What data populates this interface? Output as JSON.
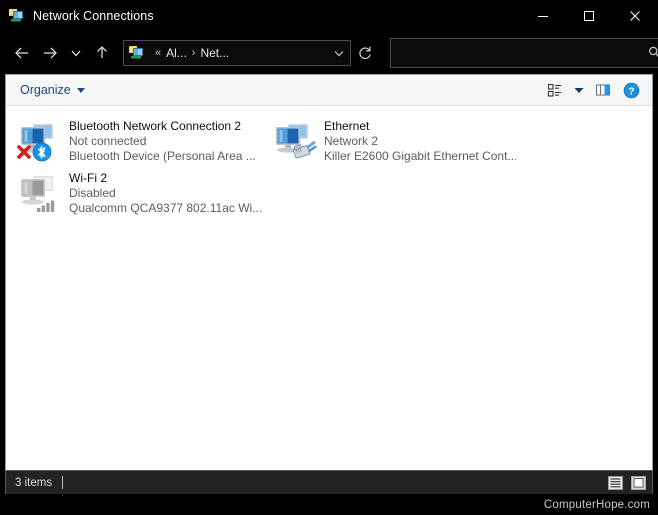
{
  "window": {
    "title": "Network Connections",
    "title_icon": "network-connections-icon",
    "minimize_label": "Minimize",
    "maximize_label": "Maximize",
    "close_label": "Close"
  },
  "nav": {
    "back_label": "Back",
    "forward_label": "Forward",
    "recent_label": "Recent locations",
    "up_label": "Up",
    "refresh_label": "Refresh",
    "address": {
      "icon": "network-connections-icon",
      "overflow": "«",
      "crumbs": [
        "Al...",
        "Net..."
      ],
      "separator": "›",
      "dropdown_label": "Previous locations"
    },
    "search": {
      "value": "",
      "placeholder": "",
      "icon": "search-icon"
    }
  },
  "toolbar": {
    "organize_label": "Organize",
    "view_options_label": "Change your view",
    "view_dropdown_label": "More options",
    "preview_pane_label": "Show the preview pane",
    "help_label": "Help"
  },
  "items": [
    {
      "name": "Bluetooth Network Connection 2",
      "status": "Not connected",
      "device": "Bluetooth Device (Personal Area ...",
      "icon": "network-adapter-bluetooth-disconnected-icon",
      "state": "disconnected"
    },
    {
      "name": "Ethernet",
      "status": "Network 2",
      "device": "Killer E2600 Gigabit Ethernet Cont...",
      "icon": "network-adapter-ethernet-icon",
      "state": "connected"
    },
    {
      "name": "Wi-Fi 2",
      "status": "Disabled",
      "device": "Qualcomm QCA9377 802.11ac Wi...",
      "icon": "network-adapter-wifi-disabled-icon",
      "state": "disabled"
    }
  ],
  "statusbar": {
    "count": "3 items",
    "details_view_label": "Details view",
    "large_icons_view_label": "Large icons view"
  },
  "watermark": {
    "text": "ComputerHope.com"
  },
  "colors": {
    "window_chrome": "#000000",
    "content_bg": "#ffffff",
    "toolbar_bg": "#f6f7f8",
    "link_blue": "#1c4b82",
    "accent_blue": "#1a8fe0",
    "error_red": "#d11f1f",
    "status_bg": "#232323"
  }
}
